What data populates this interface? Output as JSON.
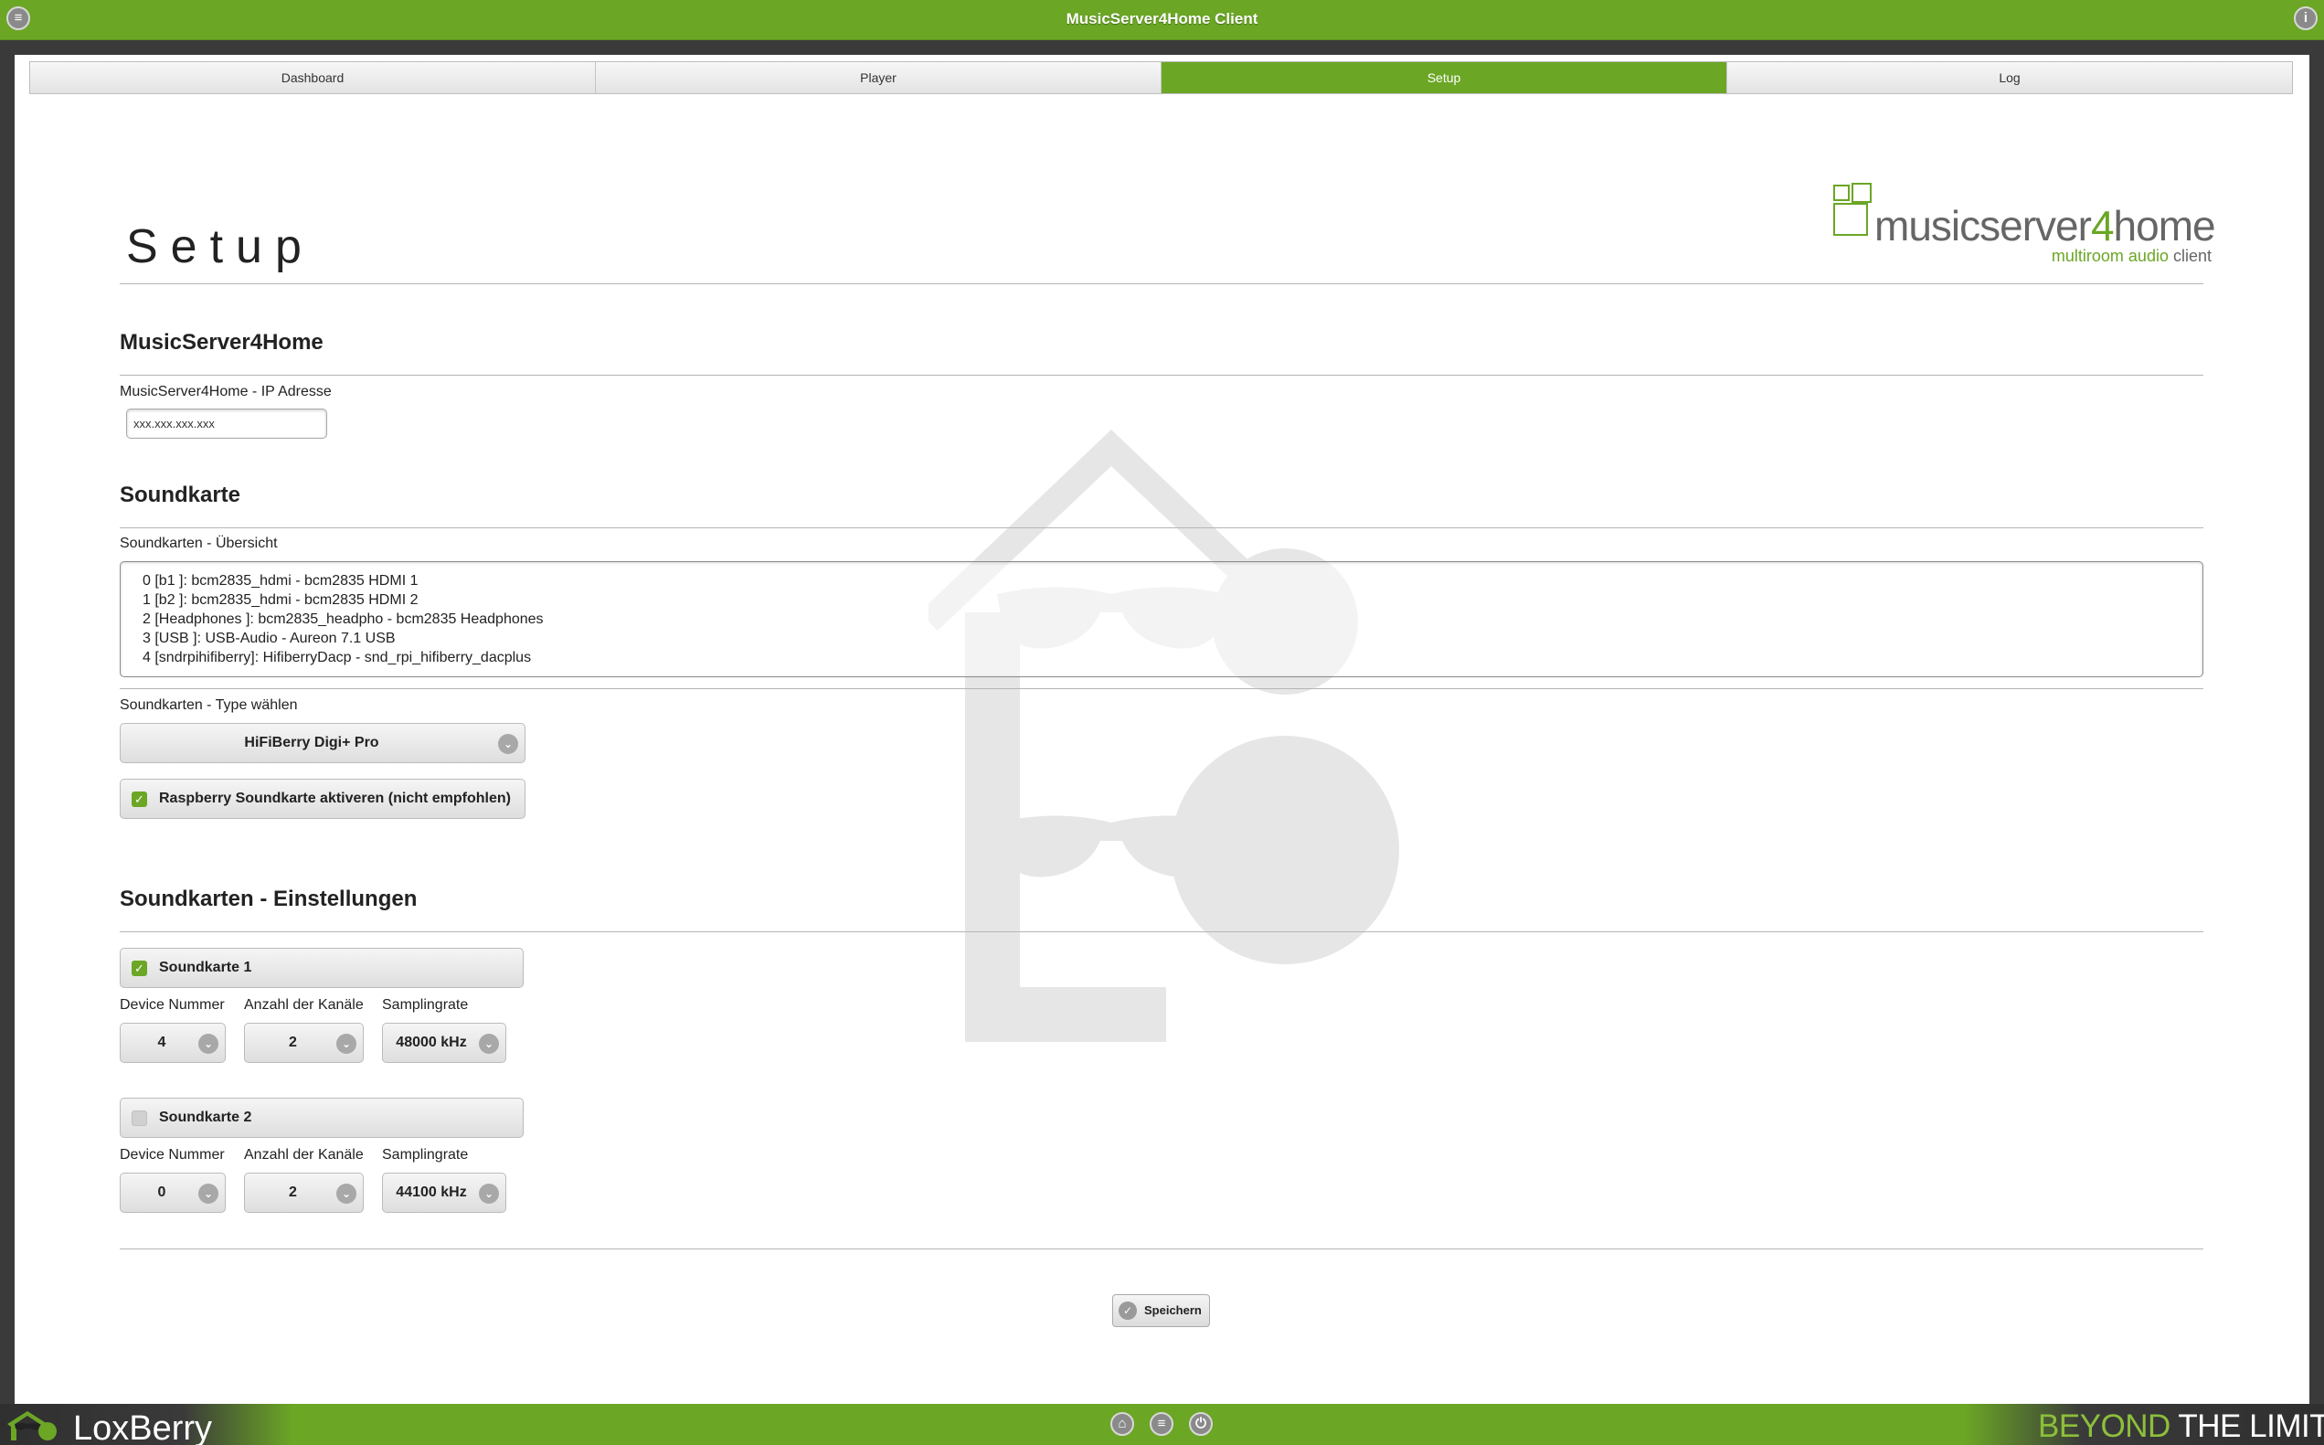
{
  "header": {
    "title": "MusicServer4Home Client",
    "menu_icon": "menu-icon",
    "info_icon": "info-icon"
  },
  "tabs": [
    {
      "label": "Dashboard",
      "active": false
    },
    {
      "label": "Player",
      "active": false
    },
    {
      "label": "Setup",
      "active": true
    },
    {
      "label": "Log",
      "active": false
    }
  ],
  "page_title": "Setup",
  "logo": {
    "main_prefix": "musicserver",
    "main_digit": "4",
    "main_suffix": "home",
    "sub_prefix": "multiroom audio",
    "sub_suffix": " client"
  },
  "section_ms4h": {
    "heading": "MusicServer4Home",
    "ip_label": "MusicServer4Home - IP Adresse",
    "ip_value": "xxx.xxx.xxx.xxx"
  },
  "section_soundcard": {
    "heading": "Soundkarte",
    "overview_label": "Soundkarten - Übersicht",
    "overview_lines": [
      "0 [b1 ]: bcm2835_hdmi - bcm2835 HDMI 1",
      "1 [b2 ]: bcm2835_hdmi - bcm2835 HDMI 2",
      "2 [Headphones ]: bcm2835_headpho - bcm2835 Headphones",
      "3 [USB ]: USB-Audio - Aureon 7.1 USB",
      "4 [sndrpihifiberry]: HifiberryDacp - snd_rpi_hifiberry_dacplus"
    ],
    "type_label": "Soundkarten - Type wählen",
    "type_value": "HiFiBerry Digi+ Pro",
    "raspberry_label": "Raspberry Soundkarte aktiveren (nicht empfohlen)",
    "raspberry_checked": true
  },
  "section_settings": {
    "heading": "Soundkarten - Einstellungen",
    "cards": [
      {
        "label": "Soundkarte 1",
        "checked": true,
        "device_label": "Device Nummer",
        "device_value": "4",
        "channels_label": "Anzahl der Kanäle",
        "channels_value": "2",
        "rate_label": "Samplingrate",
        "rate_value": "48000 kHz"
      },
      {
        "label": "Soundkarte 2",
        "checked": false,
        "device_label": "Device Nummer",
        "device_value": "0",
        "channels_label": "Anzahl der Kanäle",
        "channels_value": "2",
        "rate_label": "Samplingrate",
        "rate_value": "44100 kHz"
      }
    ]
  },
  "save_button": {
    "label": "Speichern",
    "icon": "check-icon"
  },
  "footer": {
    "brand": "LoxBerry",
    "slogan_a": "BEYOND",
    "slogan_b": " THE LIMITS",
    "icons": [
      "home-icon",
      "menu-icon",
      "power-icon"
    ]
  },
  "colors": {
    "accent": "#6ba625",
    "dark": "#3a3a3a"
  }
}
